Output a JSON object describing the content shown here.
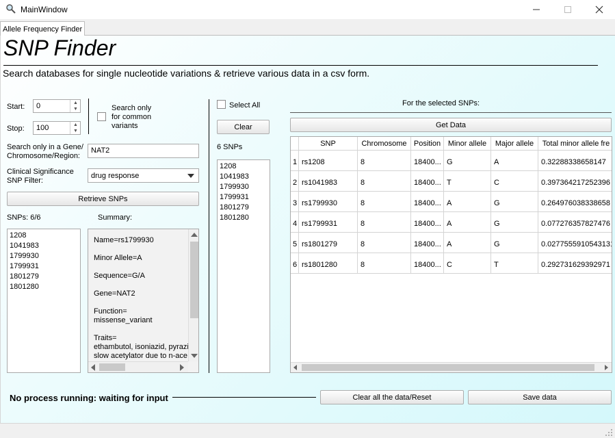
{
  "window": {
    "title": "MainWindow",
    "minimize_icon": "minimize-icon",
    "maximize_icon": "maximize-icon",
    "close_icon": "close-icon"
  },
  "tabs": [
    {
      "label": "Allele Frequency Finder"
    }
  ],
  "header": {
    "title": "SNP Finder",
    "description": "Search databases for single nucleotide variations & retrieve various data in a csv form."
  },
  "search": {
    "start_label": "Start:",
    "start_value": "0",
    "stop_label": "Stop:",
    "stop_value": "100",
    "common_variants_label": "Search only for common variants",
    "common_variants_lines": [
      "Search only",
      "for common",
      "variants"
    ],
    "common_variants_checked": false,
    "gene_label_lines": [
      "Search only in a Gene/",
      "Chromosome/Region:"
    ],
    "gene_value": "NAT2",
    "clinical_label_lines": [
      "Clinical Significance",
      "SNP Filter:"
    ],
    "clinical_value": "drug response",
    "retrieve_button": "Retrieve SNPs"
  },
  "snp_list": {
    "count_label": "SNPs: 6/6",
    "items": [
      "1208",
      "1041983",
      "1799930",
      "1799931",
      "1801279",
      "1801280"
    ]
  },
  "summary": {
    "label": "Summary:",
    "lines": [
      [
        "Name=rs1799930"
      ],
      [
        "Minor Allele=A"
      ],
      [
        "Sequence=G/A"
      ],
      [
        "Gene=NAT2"
      ],
      [
        "Function=",
        "missense_variant"
      ],
      [
        "Traits=",
        "ethambutol, isoniazid, pyrazi",
        "slow acetylator due to n-ace"
      ]
    ]
  },
  "selection": {
    "select_all_label": "Select All",
    "select_all_checked": false,
    "clear_button": "Clear",
    "count_label": "6 SNPs",
    "items": [
      "1208",
      "1041983",
      "1799930",
      "1799931",
      "1801279",
      "1801280"
    ]
  },
  "results": {
    "section_label": "For the selected SNPs:",
    "get_data_button": "Get Data",
    "columns": [
      "SNP",
      "Chromosome",
      "Position",
      "Minor allele",
      "Major allele",
      "Total minor allele fre"
    ],
    "rows": [
      {
        "num": "1",
        "cells": [
          "rs1208",
          "8",
          "18400...",
          "G",
          "A",
          "0.32288338658147"
        ]
      },
      {
        "num": "2",
        "cells": [
          "rs1041983",
          "8",
          "18400...",
          "T",
          "C",
          "0.397364217252396"
        ]
      },
      {
        "num": "3",
        "cells": [
          "rs1799930",
          "8",
          "18400...",
          "A",
          "G",
          "0.264976038338658"
        ]
      },
      {
        "num": "4",
        "cells": [
          "rs1799931",
          "8",
          "18400...",
          "A",
          "G",
          "0.077276357827476"
        ]
      },
      {
        "num": "5",
        "cells": [
          "rs1801279",
          "8",
          "18400...",
          "A",
          "G",
          "0.0277555910543131"
        ]
      },
      {
        "num": "6",
        "cells": [
          "rs1801280",
          "8",
          "18400...",
          "C",
          "T",
          "0.292731629392971"
        ]
      }
    ]
  },
  "footer": {
    "status": "No process running: waiting for input",
    "reset_button": "Clear all the data/Reset",
    "save_button": "Save data"
  }
}
